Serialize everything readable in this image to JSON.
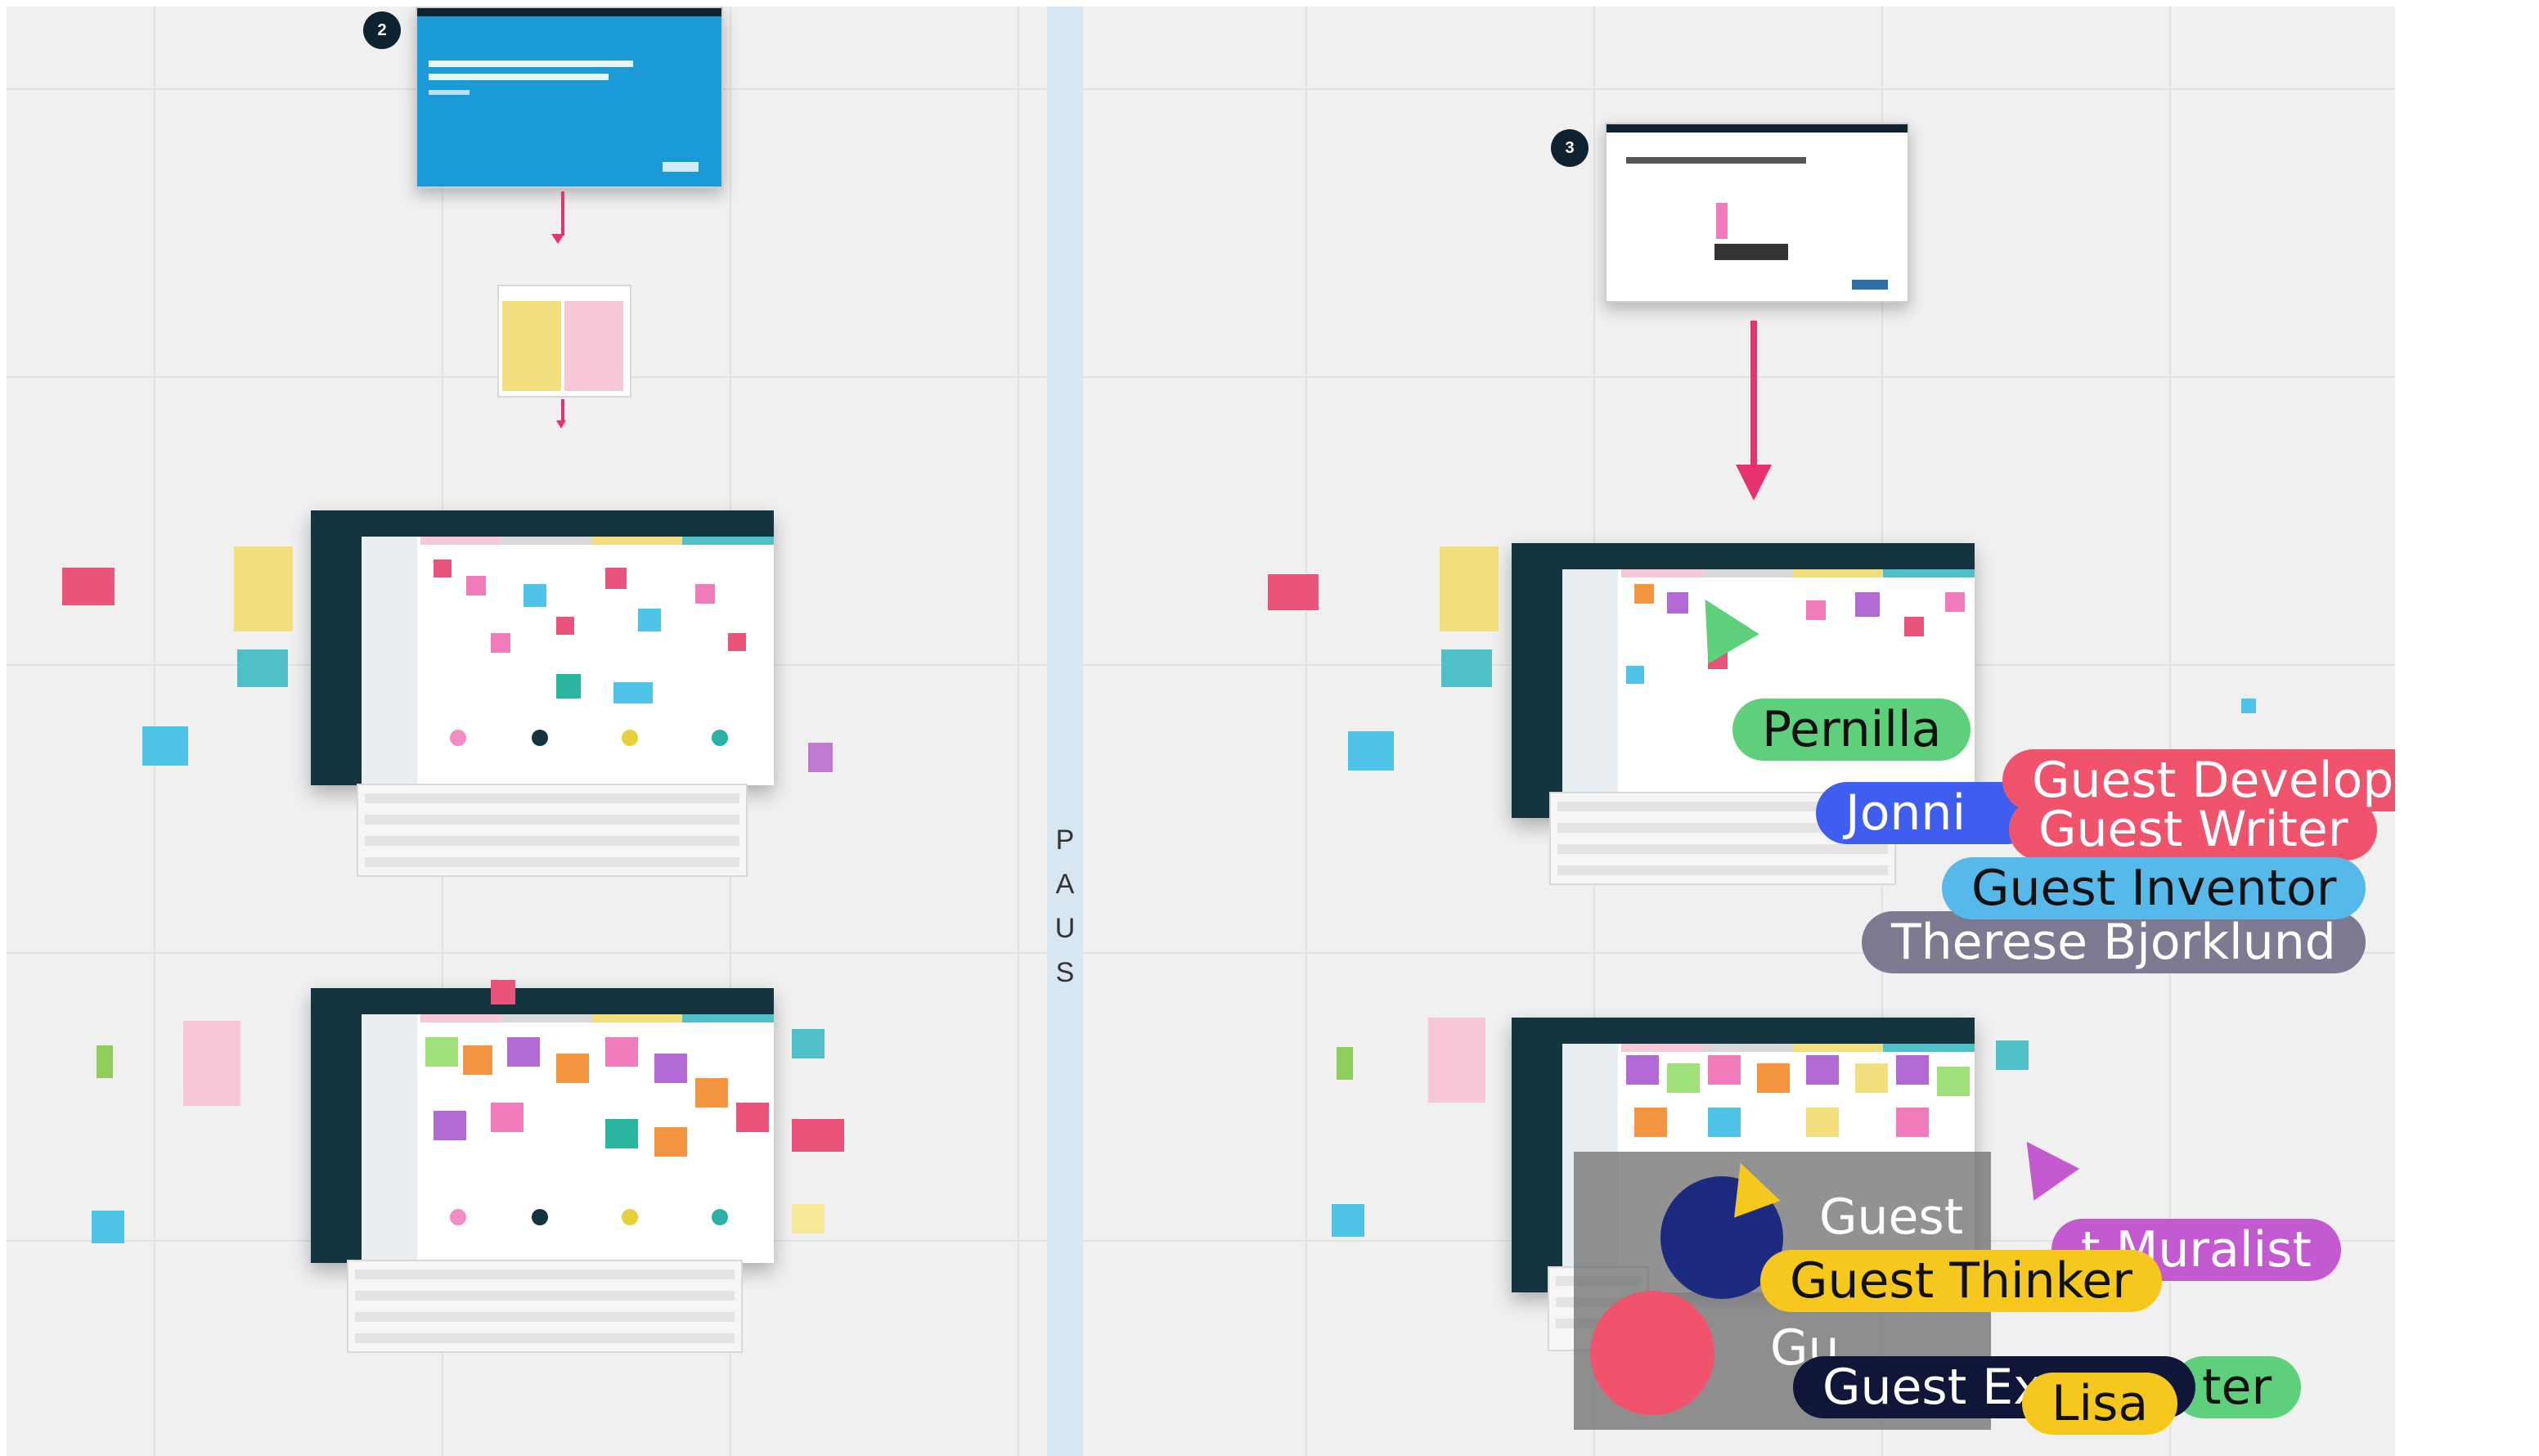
{
  "canvas": {
    "pause_label": [
      "P",
      "A",
      "U",
      "S"
    ],
    "colors": {
      "grid": "#e2e2e2",
      "background": "#f0f0f0",
      "pause_strip": "#d8e6f2",
      "arrow": "#e6336d",
      "board_dark": "#143440"
    }
  },
  "frames": {
    "frame2": {
      "number": "2",
      "slide_title": "",
      "slide_subtitle": ""
    },
    "frame3": {
      "number": "3",
      "slide_title": ""
    }
  },
  "collaborators": [
    {
      "name": "Pernilla",
      "color": "#5ecf7b"
    },
    {
      "name": "Jonni",
      "color": "#3f5ef0"
    },
    {
      "name": "Guest Developer",
      "color": "#f0536b"
    },
    {
      "name": "Guest Writer",
      "color": "#f0536b"
    },
    {
      "name": "Guest Inventor",
      "color": "#57b9ea"
    },
    {
      "name": "Therese Bjorklund",
      "color": "#7d7a92"
    },
    {
      "name": "Guest",
      "color": "#8a8a8a"
    },
    {
      "name": "Guest Muralist",
      "color": "#c45ad0"
    },
    {
      "name": "Guest Thinker",
      "color": "#f6c81e"
    },
    {
      "name": "Guest Ex",
      "color": "#101638"
    },
    {
      "name": "Lisa",
      "color": "#f6c81e"
    },
    {
      "name": "Gu",
      "color": "#6f6f6f"
    },
    {
      "name": "ter",
      "color": "#5ecf7b"
    }
  ],
  "labels": {
    "pernilla": "Pernilla",
    "jonni": "Jonni",
    "guest_developer": "Guest Developer",
    "guest_writer": "Guest Writer",
    "guest_inventor": "Guest Inventor",
    "therese": "Therese Bjorklund",
    "guest_top": "Guest",
    "guest_muralist": "t Muralist",
    "guest_thinker": "Guest Thinker",
    "guest_ex": "Guest Ex",
    "lisa": "Lisa",
    "gu": "Gu",
    "ter": "ter"
  }
}
